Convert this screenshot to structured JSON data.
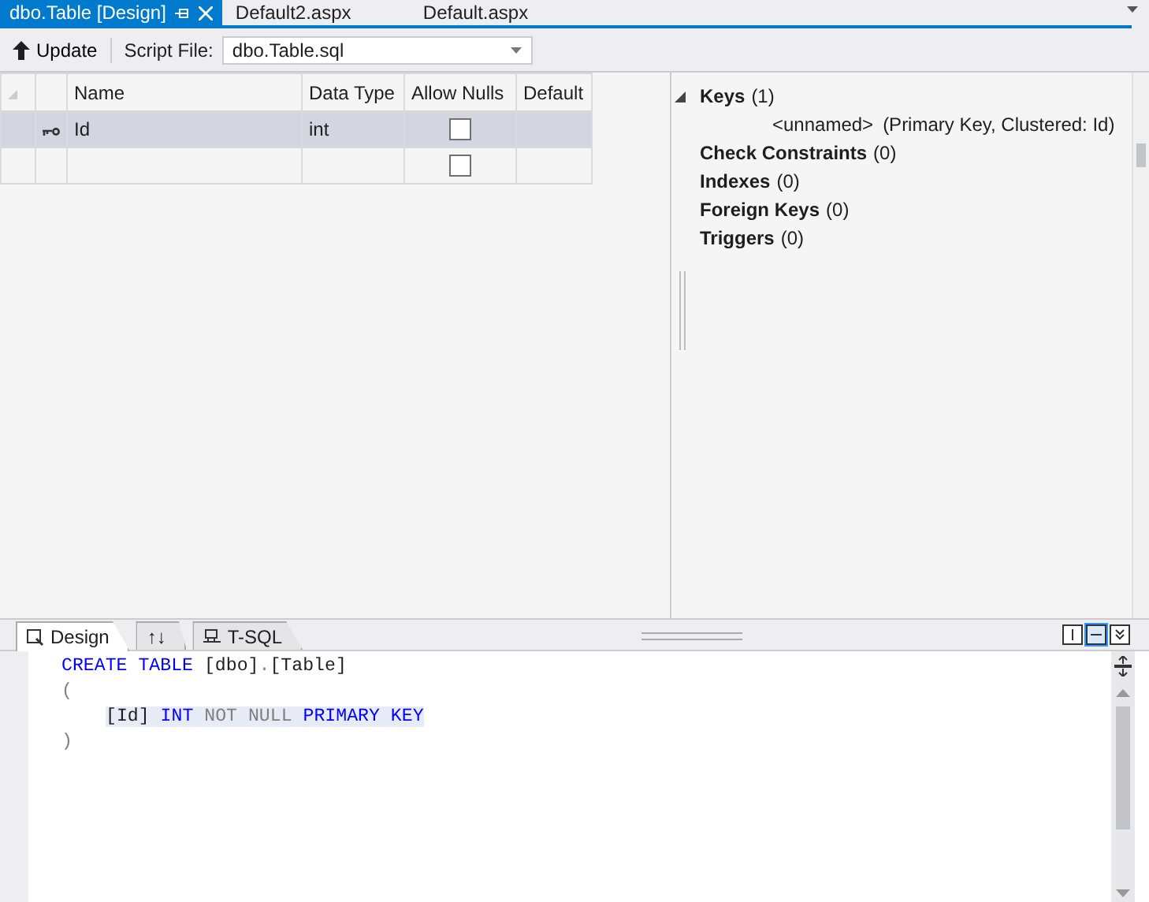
{
  "document_tabs": [
    {
      "label": "dbo.Table [Design]",
      "selected": true
    },
    {
      "label": "Default2.aspx",
      "selected": false
    },
    {
      "label": "Default.aspx",
      "selected": false
    }
  ],
  "toolbar": {
    "update_button": "Update",
    "script_file_label": "Script File:",
    "script_file": "dbo.Table.sql"
  },
  "grid": {
    "columns": [
      "Name",
      "Data Type",
      "Allow Nulls",
      "Default"
    ],
    "rows": [
      {
        "key": true,
        "selected": true,
        "name": "Id",
        "data_type": "int",
        "allow_nulls": false
      },
      {
        "key": false,
        "selected": false,
        "allow_nulls": false
      }
    ]
  },
  "properties": [
    {
      "label": "Keys",
      "count": "(1)",
      "expanded": true,
      "children": [
        {
          "label": "<unnamed>",
          "detail": "(Primary Key, Clustered: Id)"
        }
      ]
    },
    {
      "label": "Check Constraints",
      "count": "(0)"
    },
    {
      "label": "Indexes",
      "count": "(0)"
    },
    {
      "label": "Foreign Keys",
      "count": "(0)"
    },
    {
      "label": "Triggers",
      "count": "(0)"
    }
  ],
  "view_tabs": [
    {
      "label": "Design",
      "kind": "design",
      "selected": true
    },
    {
      "label": "↑↓",
      "kind": "swap",
      "selected": false
    },
    {
      "label": "T-SQL",
      "kind": "tsql",
      "selected": false
    }
  ],
  "pane_buttons": [
    {
      "kind": "vertical",
      "selected": false
    },
    {
      "kind": "horizontal",
      "selected": true
    },
    {
      "kind": "collapse",
      "selected": false
    }
  ],
  "code": [
    {
      "indent": false,
      "highlighted": false,
      "tokens": [
        {
          "text": "CREATE TABLE ",
          "kind": "keyword"
        },
        {
          "text": "[dbo]",
          "kind": "plain"
        },
        {
          "text": ".",
          "kind": "gray"
        },
        {
          "text": "[Table]",
          "kind": "plain"
        }
      ]
    },
    {
      "indent": false,
      "highlighted": false,
      "tokens": [
        {
          "text": "(",
          "kind": "gray"
        }
      ]
    },
    {
      "indent": true,
      "highlighted": true,
      "tokens": [
        {
          "text": "[Id] ",
          "kind": "plain"
        },
        {
          "text": "INT ",
          "kind": "keyword"
        },
        {
          "text": "NOT NULL ",
          "kind": "gray"
        },
        {
          "text": "PRIMARY KEY",
          "kind": "keyword"
        }
      ]
    },
    {
      "indent": false,
      "highlighted": false,
      "tokens": [
        {
          "text": ")",
          "kind": "gray"
        }
      ]
    }
  ]
}
